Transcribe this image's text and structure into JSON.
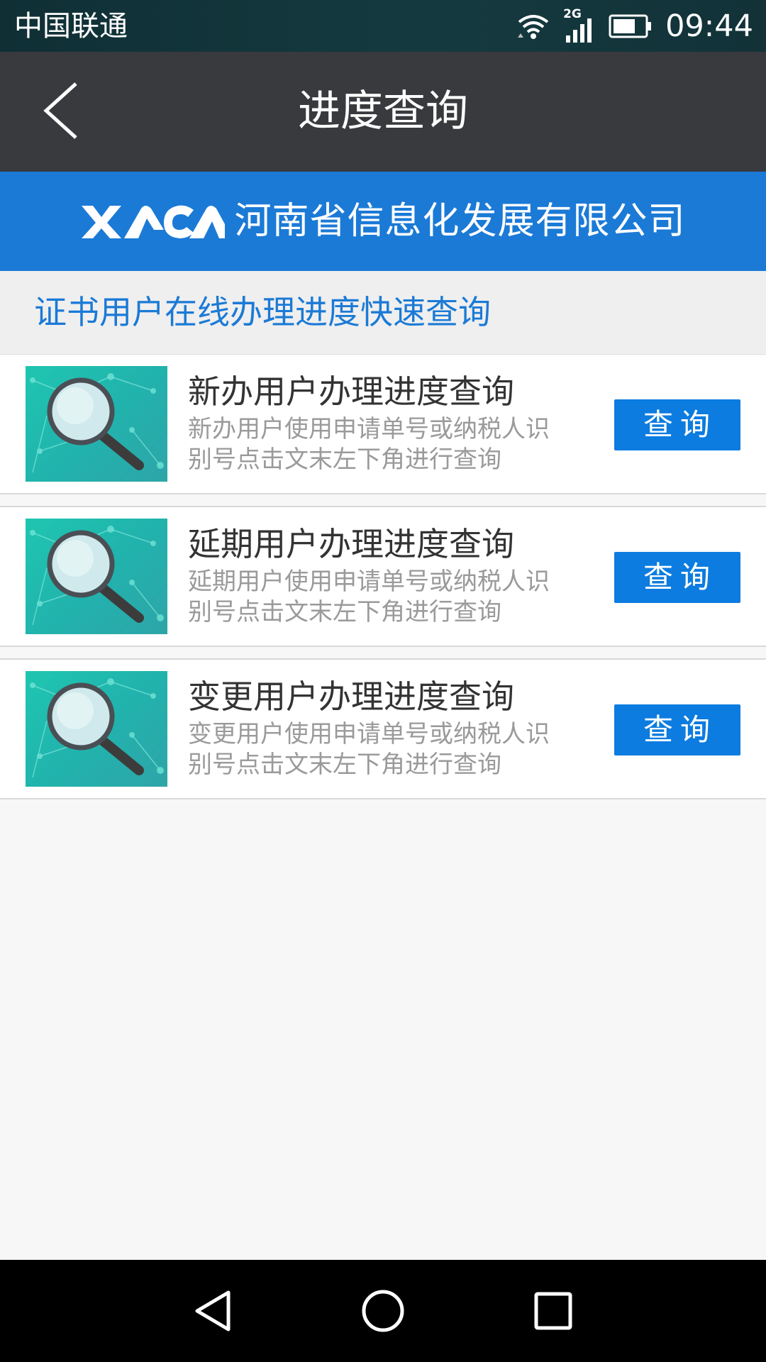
{
  "status_bar": {
    "carrier": "中国联通",
    "network": "2G",
    "time": "09:44",
    "icons": [
      "wifi-icon",
      "signal-icon",
      "battery-icon"
    ]
  },
  "header": {
    "title": "进度查询",
    "back_icon": "chevron-left-icon"
  },
  "brand": {
    "logo_text": "XACA",
    "company_name": "河南省信息化发展有限公司",
    "color": "#1b7ad6"
  },
  "section": {
    "title": "证书用户在线办理进度快速查询"
  },
  "items": [
    {
      "title": "新办用户办理进度查询",
      "description": "新办用户使用申请单号或纳税人识别号点击文末左下角进行查询",
      "button_label": "查询",
      "icon": "magnifier-icon"
    },
    {
      "title": "延期用户办理进度查询",
      "description": "延期用户使用申请单号或纳税人识别号点击文末左下角进行查询",
      "button_label": "查询",
      "icon": "magnifier-icon"
    },
    {
      "title": "变更用户办理进度查询",
      "description": "变更用户使用申请单号或纳税人识别号点击文末左下角进行查询",
      "button_label": "查询",
      "icon": "magnifier-icon"
    }
  ],
  "nav_bar": {
    "icons": [
      "back-triangle-icon",
      "home-circle-icon",
      "recents-square-icon"
    ]
  },
  "colors": {
    "accent": "#0c7ce0",
    "title_bar": "#393a3e",
    "background": "#f7f7f7"
  }
}
